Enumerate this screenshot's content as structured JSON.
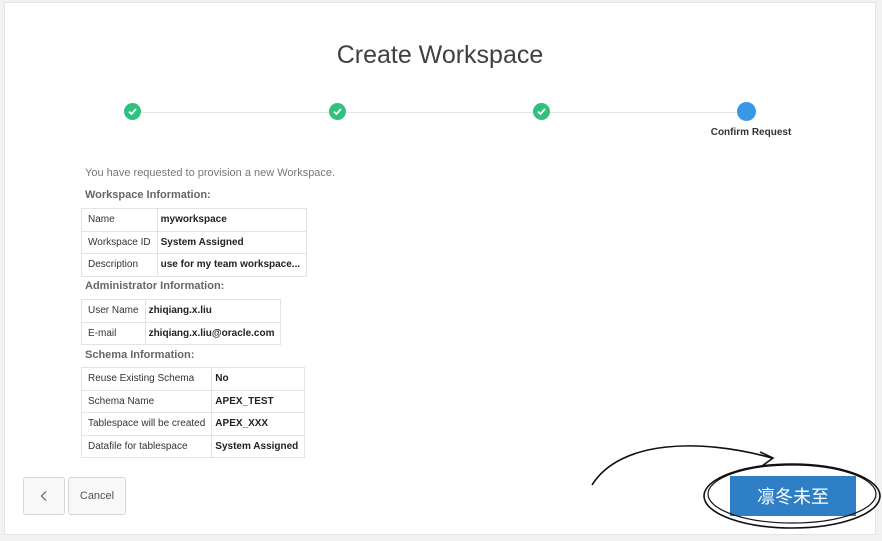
{
  "page": {
    "title": "Create Workspace"
  },
  "wizard": {
    "current_step_label": "Confirm Request"
  },
  "intro": "You have requested to provision a new Workspace.",
  "workspace": {
    "heading": "Workspace Information:",
    "rows": [
      {
        "label": "Name",
        "value": "myworkspace"
      },
      {
        "label": "Workspace ID",
        "value": "System Assigned"
      },
      {
        "label": "Description",
        "value": "use for my team workspace..."
      }
    ]
  },
  "admin": {
    "heading": "Administrator Information:",
    "rows": [
      {
        "label": "User Name",
        "value": "zhiqiang.x.liu"
      },
      {
        "label": "E-mail",
        "value": "zhiqiang.x.liu@oracle.com"
      }
    ]
  },
  "schema": {
    "heading": "Schema Information:",
    "rows": [
      {
        "label": "Reuse Existing Schema",
        "value": "No"
      },
      {
        "label": "Schema Name",
        "value": "APEX_TEST"
      },
      {
        "label": "Tablespace will be created",
        "value": "APEX_XXX"
      },
      {
        "label": "Datafile for tablespace",
        "value": "System Assigned"
      }
    ]
  },
  "footer": {
    "back_icon": "chevron-left-icon",
    "cancel_label": "Cancel",
    "primary_label": "凛冬未至"
  },
  "colors": {
    "complete": "#2ec27e",
    "current": "#3a96e6",
    "primary": "#2f7fc6"
  }
}
